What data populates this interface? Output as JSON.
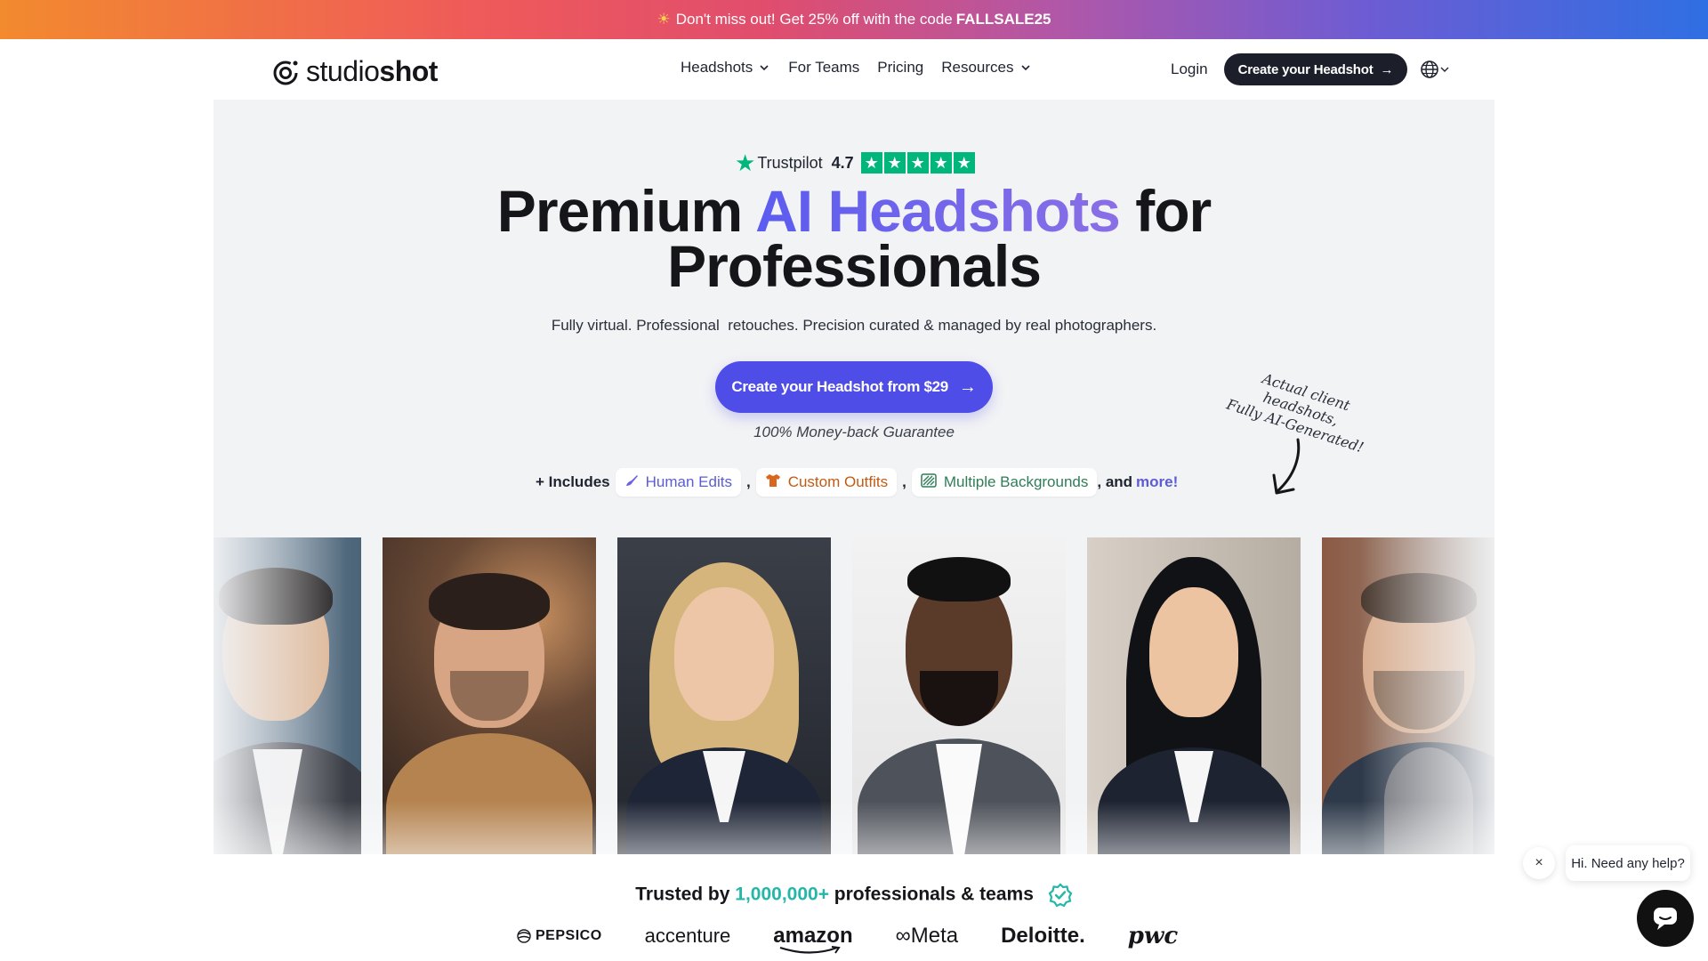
{
  "promo": {
    "icon": "sun-icon",
    "text": "Don't miss out! Get 25% off with the code",
    "code": "FALLSALE25"
  },
  "nav": {
    "logo_light": "studio",
    "logo_bold": "shot",
    "items": [
      {
        "label": "Headshots",
        "dropdown": true
      },
      {
        "label": "For Teams",
        "dropdown": false
      },
      {
        "label": "Pricing",
        "dropdown": false
      },
      {
        "label": "Resources",
        "dropdown": true
      }
    ],
    "login": "Login",
    "cta": "Create your Headshot",
    "cta_arrow": "→"
  },
  "hero": {
    "trustpilot": {
      "label": "Trustpilot",
      "rating": "4.7",
      "stars": 5,
      "star_color": "#00b67a"
    },
    "title_part1": "Premium ",
    "title_accent": "AI Headshots",
    "title_part2": " for",
    "title_line2": "Professionals",
    "subtitle": "Fully virtual. Professional  retouches. Precision curated & managed by real photographers.",
    "cta": "Create your Headshot from $29",
    "cta_arrow": "→",
    "guarantee": "100% Money-back Guarantee",
    "includes_lead": "+ Includes",
    "chips": [
      {
        "label": "Human Edits",
        "icon": "brush-icon",
        "color": "#5b5cd6"
      },
      {
        "label": "Custom Outfits",
        "icon": "shirt-icon",
        "color": "#c45a12"
      },
      {
        "label": "Multiple Backgrounds",
        "icon": "background-icon",
        "color": "#2e7d56"
      }
    ],
    "comma": ",",
    "and": ", and",
    "more": "more!",
    "note_line1": "Actual client headshots,",
    "note_line2": "Fully AI-Generated!"
  },
  "trusted": {
    "prefix": "Trusted by ",
    "number": "1,000,000+",
    "suffix": " professionals & teams",
    "logos": [
      "PEPSICO",
      "accenture",
      "amazon",
      "Meta",
      "Deloitte.",
      "pwc"
    ]
  },
  "chat": {
    "close": "×",
    "bubble": "Hi. Need any help?"
  },
  "colors": {
    "accent": "#4f4de8",
    "teal": "#24b7a8",
    "dark_button": "#1c1f2a"
  }
}
